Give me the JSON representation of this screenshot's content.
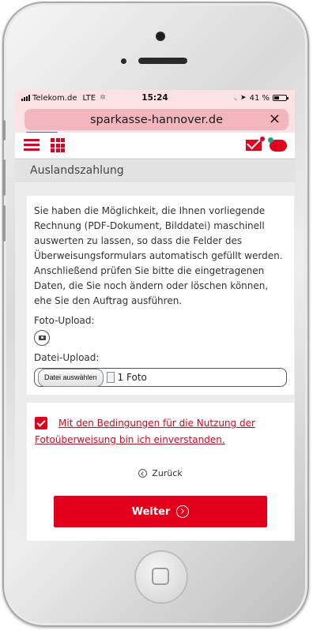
{
  "status_bar": {
    "carrier": "Telekom.de",
    "network": "LTE",
    "time": "15:24",
    "battery": "41 %"
  },
  "browser": {
    "url": "sparkasse-hannover.de",
    "close_label": "×"
  },
  "page": {
    "section_title": "Auslandszahlung",
    "description": "Sie haben die Möglichkeit, die Ihnen vorliegende Rechnung (PDF-Dokument, Bilddatei) maschinell auswerten zu lassen, so dass die Felder des Überweisungsformulars automatisch gefüllt werden. Anschließend prüfen Sie bitte die eingetragenen Daten, die Sie noch ändern oder löschen können, ehe Sie den Auftrag ausführen.",
    "photo_upload_label": "Foto-Upload:",
    "file_upload_label": "Datei-Upload:",
    "file_button_label": "Datei auswählen",
    "file_status": "1 Foto",
    "terms_line1": "Mit den Bedingungen für die Nutzung der",
    "terms_line2": "Fotoüberweisung bin ich einverstanden.",
    "terms_checked": true,
    "back_label": "Zurück",
    "next_label": "Weiter"
  },
  "colors": {
    "brand_red": "#e3001b",
    "url_bar": "#f3b6bd"
  }
}
